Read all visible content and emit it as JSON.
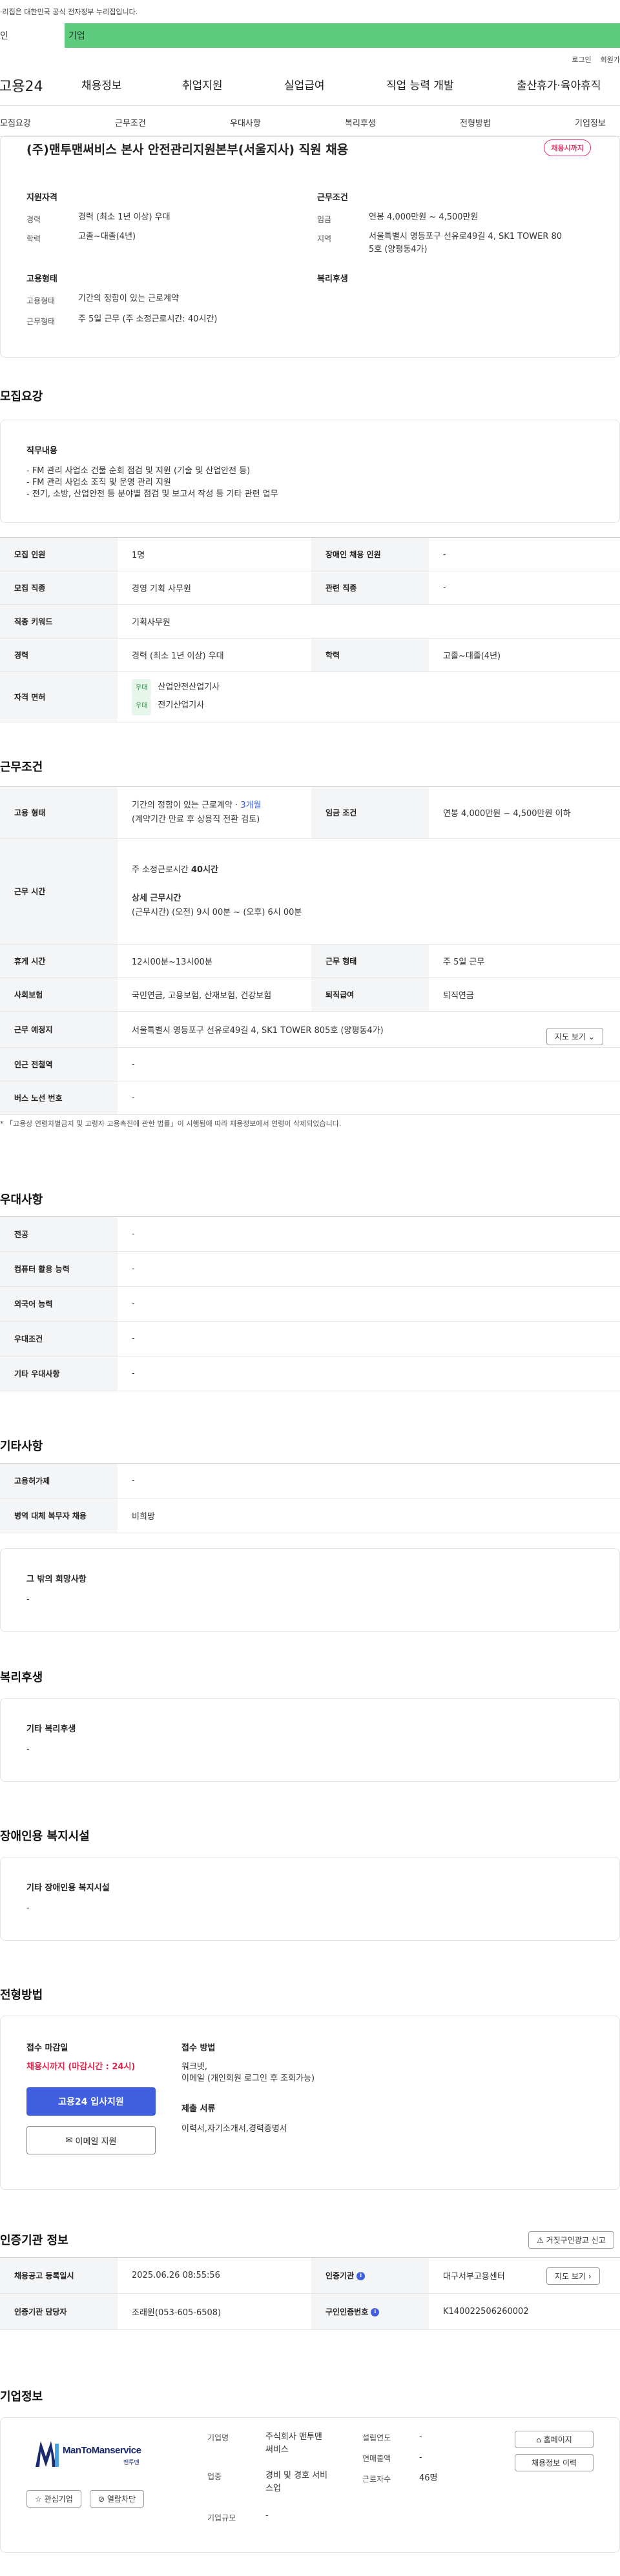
{
  "gov_banner": "·리집은 대한민국 공식 전자정부 누리집입니다.",
  "user_tabs": {
    "individual": "인",
    "company": "기업"
  },
  "util": {
    "login": "로그인",
    "join": "회원가"
  },
  "gnb": {
    "logo": "고용24",
    "items": [
      "채용정보",
      "취업지원",
      "실업급여",
      "직업 능력 개발",
      "출산휴가·육아휴직"
    ]
  },
  "tabs": [
    "모집요강",
    "근무조건",
    "우대사항",
    "복리후생",
    "전형방법",
    "기업정보"
  ],
  "job": {
    "title": "(주)맨투맨써비스 본사 안전관리지원본부(서울지사) 직원 채용",
    "badge": "채용시까지",
    "qual_head": "지원자격",
    "career_label": "경력",
    "career_value": "경력 (최소 1년 이상) 우대",
    "edu_label": "학력",
    "edu_value": "고졸~대졸(4년)",
    "emp_head": "고용형태",
    "emp_label1": "고용형태",
    "emp_value1": "기간의 정함이 있는 근로계약",
    "emp_label2": "근무형태",
    "emp_value2": "주 5일 근무 (주 소정근로시간: 40시간)",
    "work_head": "근무조건",
    "wage_label": "임금",
    "wage_value": "연봉 4,000만원 ~ 4,500만원",
    "region_label": "지역",
    "region_value1": "서울특별시 영등포구 선유로49길 4, SK1 TOWER 80",
    "region_value2": "5호 (양평동4가)",
    "welfare_head": "복리후생"
  },
  "recruit": {
    "title": "모집요강",
    "duty_head": "직무내용",
    "duties": [
      "- FM 관리 사업소 건물 순회 점검 및 지원 (기술 및 산업안전 등)",
      "- FM 관리 사업소 조직 및 운영 관리 지원",
      "- 전기, 소방, 산업안전 등 분야별 점검 및 보고서 작성 등 기타 관련 업무"
    ],
    "rows": {
      "count_label": "모집 인원",
      "count_value": "1명",
      "disabled_label": "장애인 채용 인원",
      "disabled_value": "-",
      "job_label": "모집 직종",
      "job_value": "경영 기획 사무원",
      "related_label": "관련 직종",
      "related_value": "-",
      "keyword_label": "직종 키워드",
      "keyword_value": "기획사무원",
      "career_label": "경력",
      "career_value": "경력 (최소 1년 이상) 우대",
      "edu_label": "학력",
      "edu_value": "고졸~대졸(4년)",
      "license_label": "자격 면허",
      "licenses": [
        {
          "chip": "우대",
          "name": "산업안전산업기사"
        },
        {
          "chip": "우대",
          "name": "전기산업기사"
        }
      ]
    }
  },
  "conditions": {
    "title": "근무조건",
    "emp_label": "고용 형태",
    "emp_value": "기간의 정함이 있는 근로계약 · ",
    "emp_months": "3개월",
    "emp_note": "(계약기간 만료 후 상용직 전환 검토)",
    "wage_label": "임금 조건",
    "wage_value": "연봉 4,000만원 ~ 4,500만원 이하",
    "hours_label": "근무 시간",
    "hours_head": "주 소정근로시간 ",
    "hours_value": "40시간",
    "detail_head": "상세 근무시간",
    "detail_value": "(근무시간) (오전) 9시 00분 ~ (오후) 6시 00분",
    "break_label": "휴게 시간",
    "break_value": "12시00분~13시00분",
    "type_label": "근무 형태",
    "type_value": "주 5일 근무",
    "insurance_label": "사회보험",
    "insurance_value": "국민연금, 고용보험, 산재보험, 건강보험",
    "retire_label": "퇴직급여",
    "retire_value": "퇴직연금",
    "place_label": "근무 예정지",
    "place_value": "서울특별시 영등포구 선유로49길 4, SK1 TOWER 805호 (양평동4가)",
    "map_button": "지도 보기",
    "subway_label": "인근 전철역",
    "subway_value": "-",
    "bus_label": "버스 노선 번호",
    "bus_value": "-",
    "note": "* 「고용상 연령차별금지 및 고령자 고용촉진에 관한 법률」이 시행됨에 따라 채용정보에서 연령이 삭제되었습니다."
  },
  "preference": {
    "title": "우대사항",
    "rows": [
      {
        "label": "전공",
        "value": "-"
      },
      {
        "label": "컴퓨터 활용 능력",
        "value": "-"
      },
      {
        "label": "외국어 능력",
        "value": "-"
      },
      {
        "label": "우대조건",
        "value": "-"
      },
      {
        "label": "기타 우대사항",
        "value": "-"
      }
    ]
  },
  "other": {
    "title": "기타사항",
    "hire_label": "고용허가제",
    "hire_value": "-",
    "military_label": "병역 대체 복무자 채용",
    "military_value": "비희망",
    "wish_head": "그 밖의 희망사항",
    "wish_value": "-"
  },
  "welfare": {
    "title": "복리후생",
    "head": "기타 복리후생",
    "value": "-"
  },
  "disability": {
    "title": "장애인용 복지시설",
    "head": "기타 장애인용 복지시설",
    "value": "-"
  },
  "screening": {
    "title": "전형방법",
    "deadline_head": "접수 마감일",
    "deadline_value": "채용시까지 (마감시간 : 24시)",
    "apply_button": "고용24 입사지원",
    "email_button": "이메일 지원",
    "method_head": "접수 방법",
    "method_value1": "워크넷,",
    "method_value2": "이메일 (개인회원 로그인 후 조회가능)",
    "docs_head": "제출 서류",
    "docs_value": "이력서,자기소개서,경력증명서"
  },
  "agency": {
    "title": "인증기관 정보",
    "report_button": "거짓구인광고 신고",
    "date_label": "채용공고 등록일시",
    "date_value": "2025.06.26 08:55:56",
    "agency_label": "인증기관",
    "agency_value": "대구서부고용센터",
    "map_button": "지도 보기",
    "manager_label": "인증기관 담당자",
    "manager_value": "조래원(053-605-6508)",
    "auth_label": "구인인증번호",
    "auth_value": "K140022506260002"
  },
  "company": {
    "title": "기업정보",
    "logo_text": "ManToManservice",
    "logo_sub": "맨투맨",
    "fav_button": "관심기업",
    "block_button": "열람차단",
    "name_label": "기업명",
    "name_value1": "주식회사 맨투맨",
    "name_value2": "써비스",
    "industry_label": "업종",
    "industry_value1": "경비 및 경호 서비",
    "industry_value2": "스업",
    "size_label": "기업규모",
    "size_value": "-",
    "founded_label": "설립연도",
    "founded_value": "-",
    "sales_label": "연매출액",
    "sales_value": "-",
    "employees_label": "근로자수",
    "employees_value": "46명",
    "home_button": "홈페이지",
    "history_button": "채용정보 이력"
  }
}
